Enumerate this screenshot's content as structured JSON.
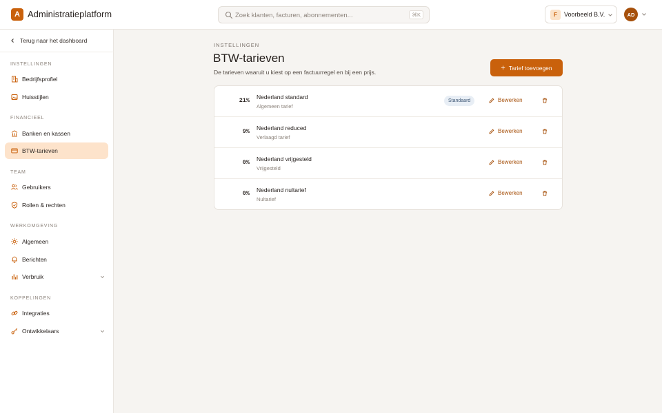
{
  "app": {
    "logo_letter": "A",
    "title": "Administratieplatform"
  },
  "search": {
    "placeholder": "Zoek klanten, facturen, abonnementen...",
    "shortcut": "⌘K"
  },
  "org": {
    "badge": "F",
    "name": "Voorbeeld B.V."
  },
  "user": {
    "initials": "AD"
  },
  "sidebar": {
    "back_label": "Terug naar het dashboard",
    "sections": [
      {
        "title": "INSTELLINGEN",
        "items": [
          {
            "label": "Bedrijfsprofiel",
            "icon": "building-icon"
          },
          {
            "label": "Huisstijlen",
            "icon": "image-icon"
          }
        ]
      },
      {
        "title": "FINANCIEEL",
        "items": [
          {
            "label": "Banken en kassen",
            "icon": "bank-icon"
          },
          {
            "label": "BTW-tarieven",
            "icon": "card-icon",
            "active": true
          }
        ]
      },
      {
        "title": "TEAM",
        "items": [
          {
            "label": "Gebruikers",
            "icon": "users-icon"
          },
          {
            "label": "Rollen & rechten",
            "icon": "shield-icon"
          }
        ]
      },
      {
        "title": "WERKOMGEVING",
        "items": [
          {
            "label": "Algemeen",
            "icon": "sun-icon"
          },
          {
            "label": "Berichten",
            "icon": "bell-icon"
          },
          {
            "label": "Verbruik",
            "icon": "bar-chart-icon",
            "expandable": true
          }
        ]
      },
      {
        "title": "KOPPELINGEN",
        "items": [
          {
            "label": "Integraties",
            "icon": "link-icon"
          },
          {
            "label": "Ontwikkelaars",
            "icon": "key-icon",
            "expandable": true
          }
        ]
      }
    ]
  },
  "main": {
    "eyebrow": "INSTELLINGEN",
    "title": "BTW-tarieven",
    "subtitle": "De tarieven waaruit u kiest op een factuurregel en bij een prijs.",
    "add_button": "Tarief toevoegen",
    "edit_label": "Bewerken",
    "rates": [
      {
        "rate": "21%",
        "name": "Nederland standard",
        "description": "Algemeen tarief",
        "badge": "Standaard"
      },
      {
        "rate": "9%",
        "name": "Nederland reduced",
        "description": "Verlaagd tarief"
      },
      {
        "rate": "0%",
        "name": "Nederland vrijgesteld",
        "description": "Vrijgesteld"
      },
      {
        "rate": "0%",
        "name": "Nederland nultarief",
        "description": "Nultarief"
      }
    ]
  },
  "colors": {
    "accent": "#c9610c",
    "active_bg": "#fde3cb",
    "badge_bg": "#e8eef5"
  }
}
